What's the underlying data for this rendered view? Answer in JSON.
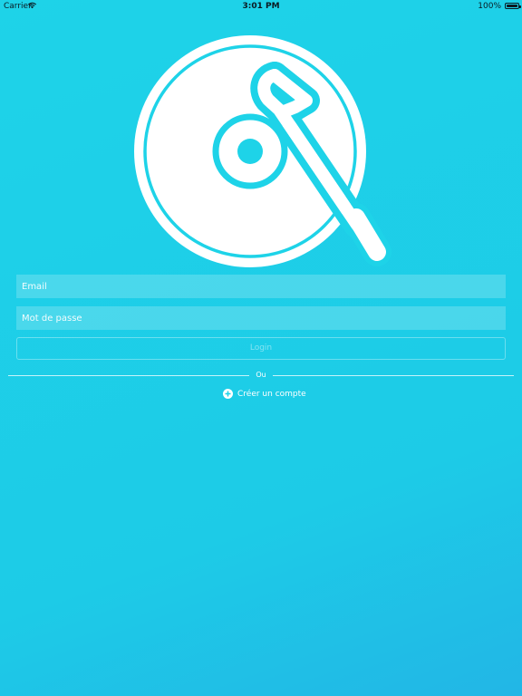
{
  "status_bar": {
    "carrier": "Carrier",
    "time": "3:01 PM",
    "battery": "100%"
  },
  "icons": {
    "logo": "turntable-record-icon",
    "wifi": "wifi-icon",
    "battery": "battery-icon",
    "create": "plus-circle-icon"
  },
  "colors": {
    "background": "#1ed3e8",
    "accent": "#ffffff"
  },
  "login_form": {
    "email_placeholder": "Email",
    "password_placeholder": "Mot de passe",
    "login_label": "Login",
    "divider_text": "Ou",
    "create_account_label": "Créer un compte"
  }
}
